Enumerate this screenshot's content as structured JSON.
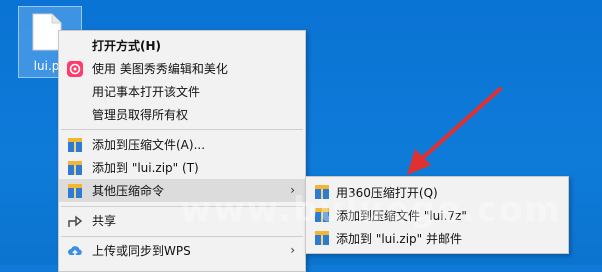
{
  "desktop": {
    "file": {
      "label": "lui.pk",
      "icon": "file-icon"
    }
  },
  "context_menu": {
    "items": [
      {
        "label": "打开方式(H)",
        "icon": null,
        "bold": true
      },
      {
        "label": "使用 美图秀秀编辑和美化",
        "icon": "meitu-icon"
      },
      {
        "label": "用记事本打开该文件",
        "icon": null
      },
      {
        "label": "管理员取得所有权",
        "icon": null
      },
      {
        "label": "添加到压缩文件(A)...",
        "icon": "archive-icon"
      },
      {
        "label": "添加到 \"lui.zip\" (T)",
        "icon": "archive-icon"
      },
      {
        "label": "其他压缩命令",
        "icon": "archive-icon",
        "submenu": true
      },
      {
        "label": "共享",
        "icon": "share-icon"
      },
      {
        "label": "上传或同步到WPS",
        "icon": "wps-cloud-icon",
        "submenu": true
      }
    ],
    "arrow_glyph": "›"
  },
  "submenu": {
    "items": [
      {
        "label": "用360压缩打开(Q)",
        "icon": "archive-icon"
      },
      {
        "label": "添加到压缩文件 \"lui.7z\"",
        "icon": "archive-icon"
      },
      {
        "label": "添加到 \"lui.zip\" 并邮件",
        "icon": "archive-icon"
      }
    ]
  },
  "watermark": "www.buluoge.com",
  "colors": {
    "desktop": "#0f7ad8",
    "annotation_arrow": "#e03030",
    "menu_bg": "#f2f2f2"
  }
}
